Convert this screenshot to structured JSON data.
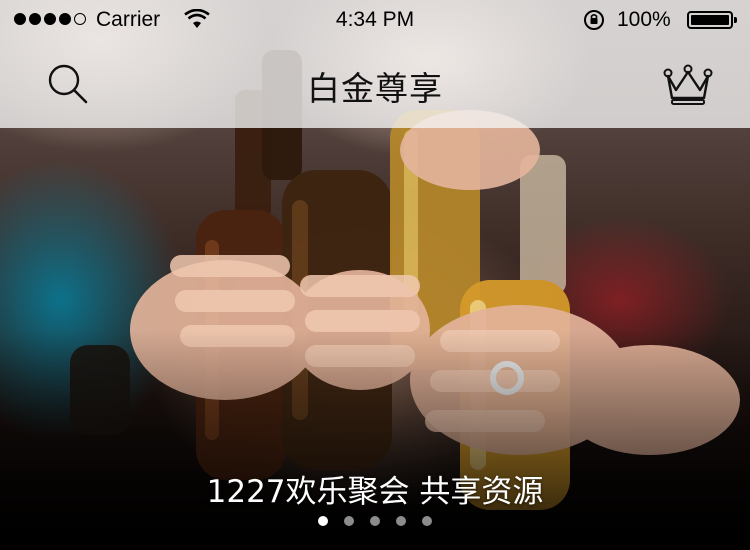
{
  "status_bar": {
    "carrier": "Carrier",
    "time": "4:34 PM",
    "battery_percent": "100%",
    "signal_bars_filled": 4,
    "signal_bars_total": 5
  },
  "nav_bar": {
    "title": "白金尊享",
    "left_icon": "search-icon",
    "right_icon": "crown-icon"
  },
  "banner": {
    "caption": "1227欢乐聚会 共享资源",
    "page_count": 5,
    "active_page": 1
  },
  "colors": {
    "nav_bg": "#f5f5f5",
    "text_dark": "#111111",
    "dot_active": "#ffffff",
    "dot_inactive": "#bbbbbb"
  }
}
